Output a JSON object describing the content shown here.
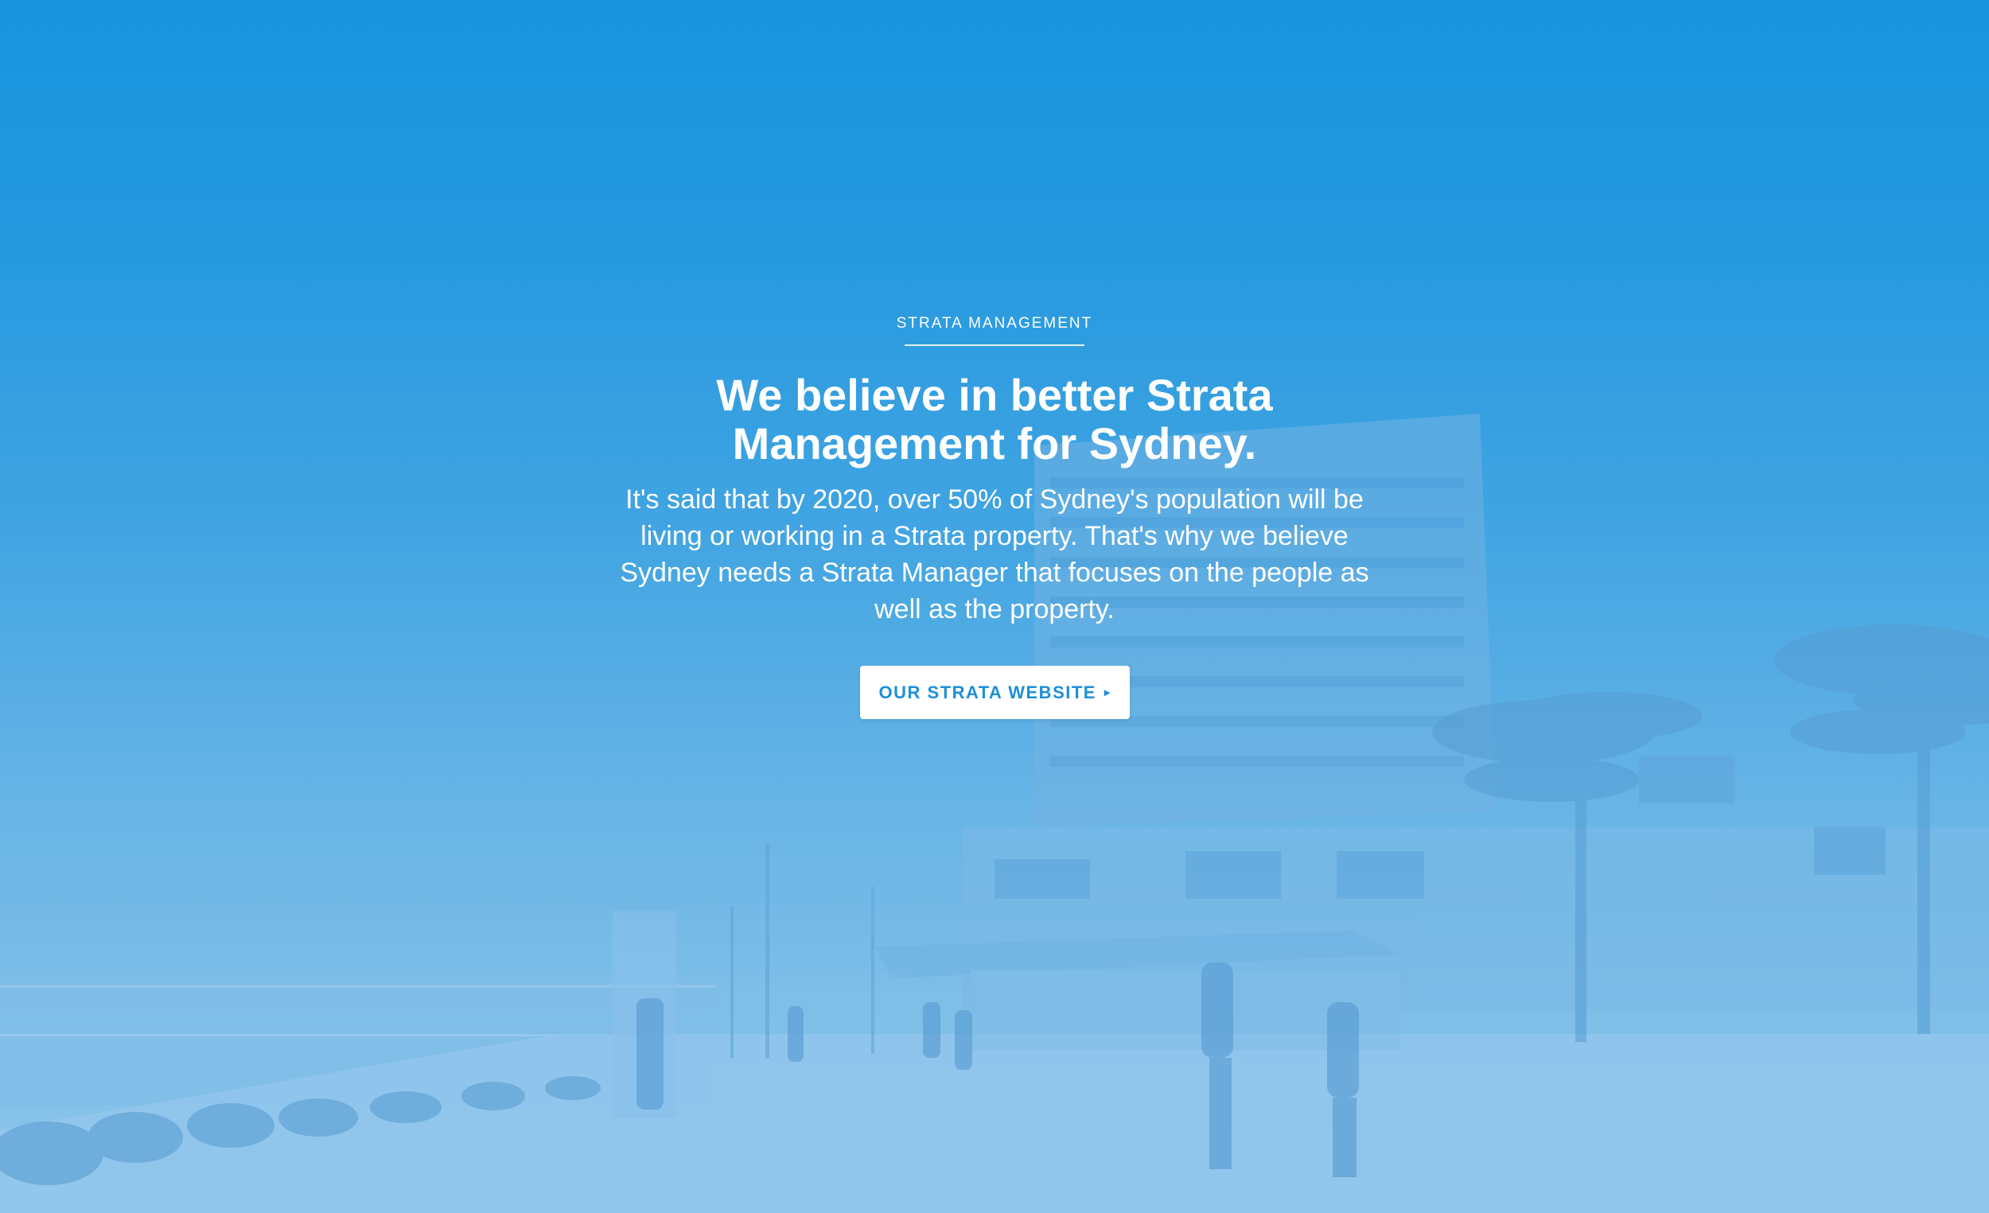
{
  "hero": {
    "eyebrow": "STRATA MANAGEMENT",
    "headline": "We believe in better Strata Management for Sydney.",
    "body": "It's said that by 2020, over 50% of Sydney's population will be living or working in a Strata property. That's why we believe Sydney needs a Strata Manager that focuses on the people as well as the property.",
    "cta_label": "OUR STRATA WEBSITE",
    "cta_arrow": "▸"
  },
  "colors": {
    "overlay_blue": "#1795df",
    "cta_text": "#1e8fd8",
    "text": "#ffffff"
  }
}
